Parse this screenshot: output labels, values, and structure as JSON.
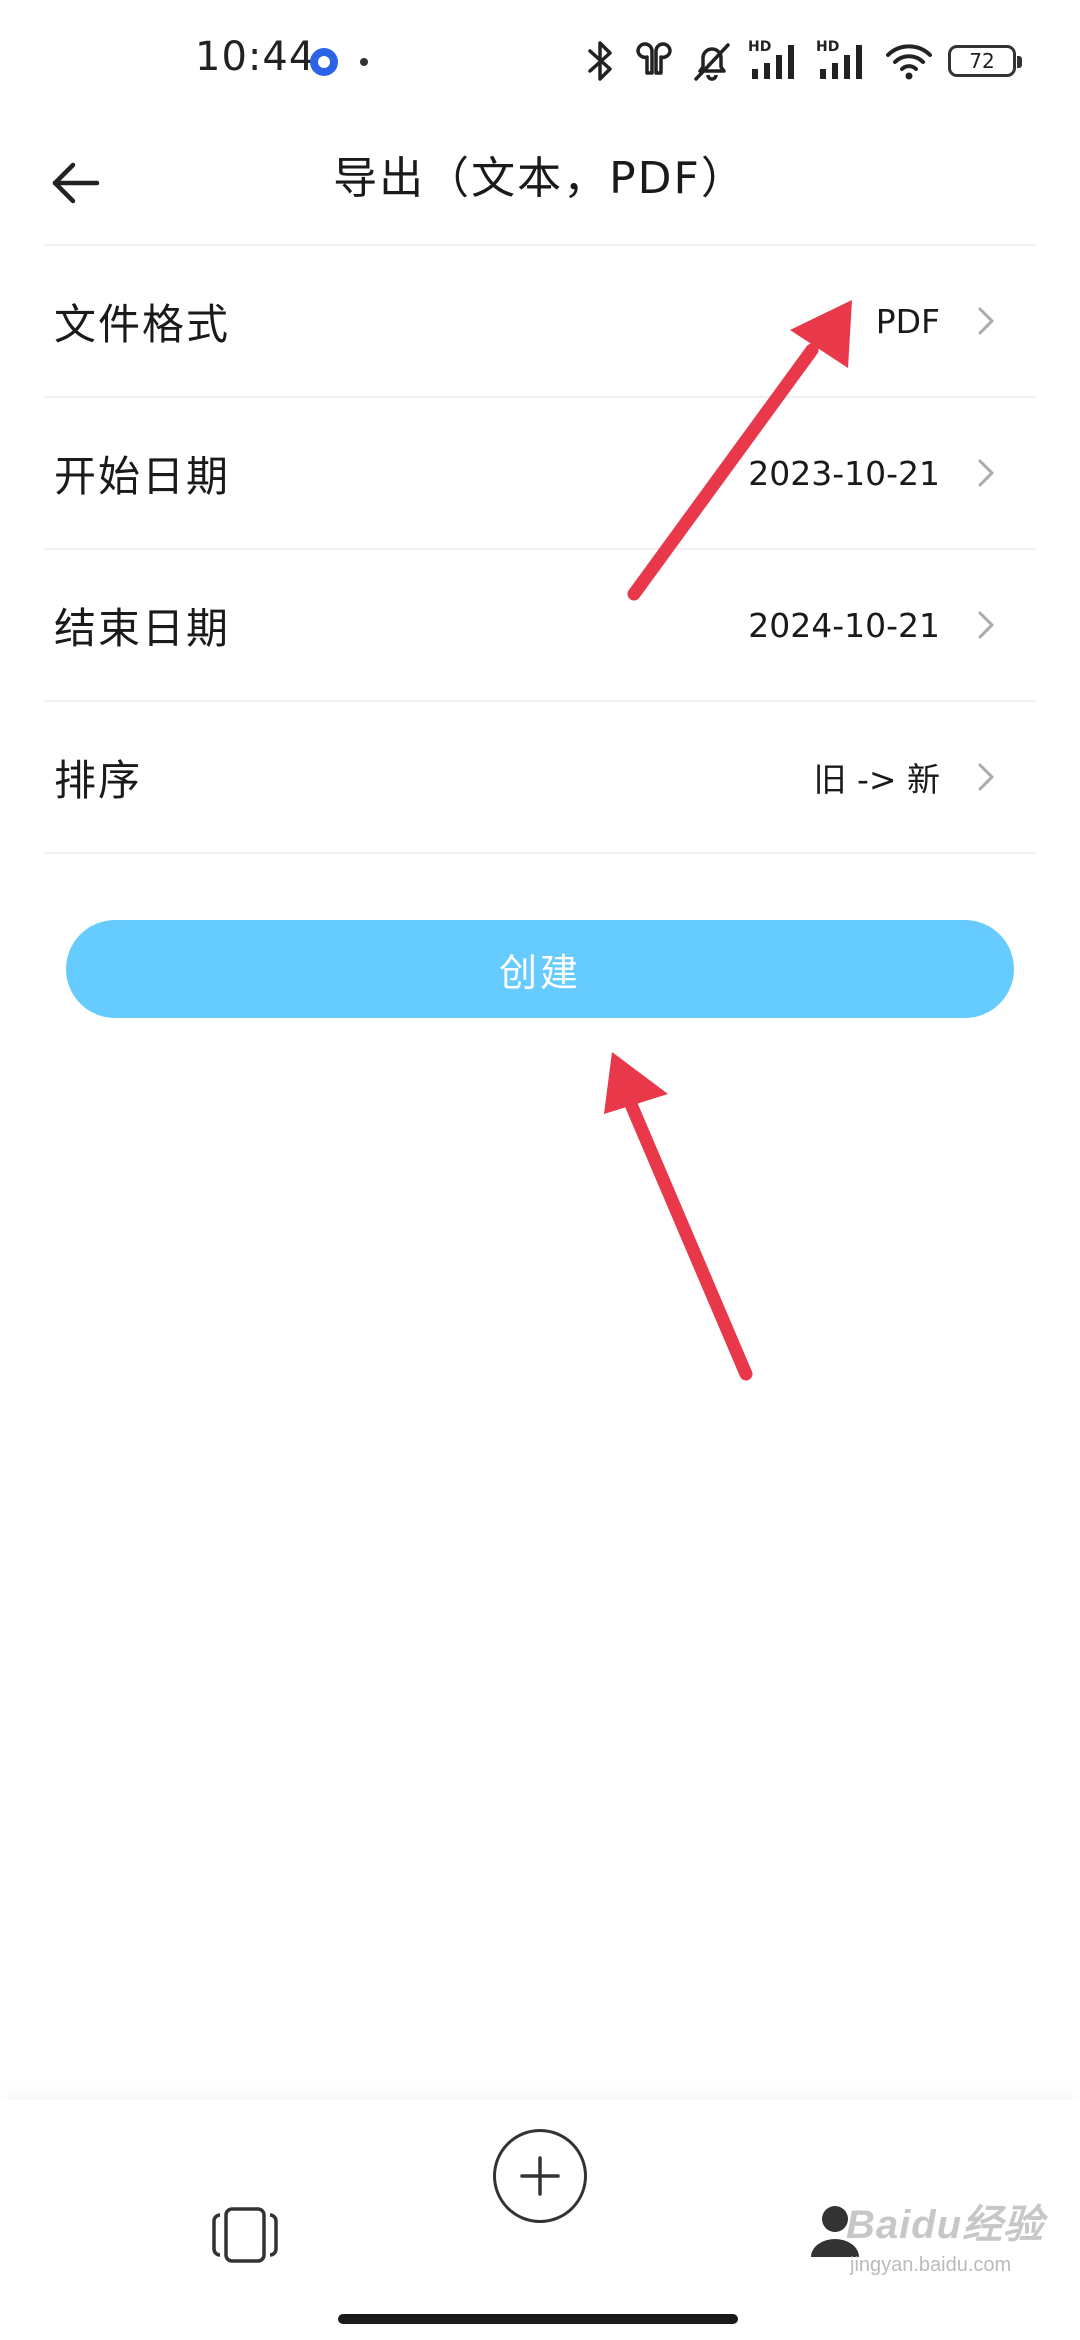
{
  "status_bar": {
    "time": "10:44",
    "battery": "72",
    "hd_label": "HD"
  },
  "header": {
    "title": "导出（文本，PDF）"
  },
  "settings": [
    {
      "label": "文件格式",
      "value": "PDF"
    },
    {
      "label": "开始日期",
      "value": "2023-10-21"
    },
    {
      "label": "结束日期",
      "value": "2024-10-21"
    },
    {
      "label": "排序",
      "value": "旧 -> 新"
    }
  ],
  "create_button": {
    "label": "创建"
  },
  "watermark": {
    "text": "Baidu经验",
    "subtext": "jingyan.baidu.com"
  },
  "colors": {
    "accent": "#66ccff",
    "annotation_arrow": "#e8384a"
  }
}
